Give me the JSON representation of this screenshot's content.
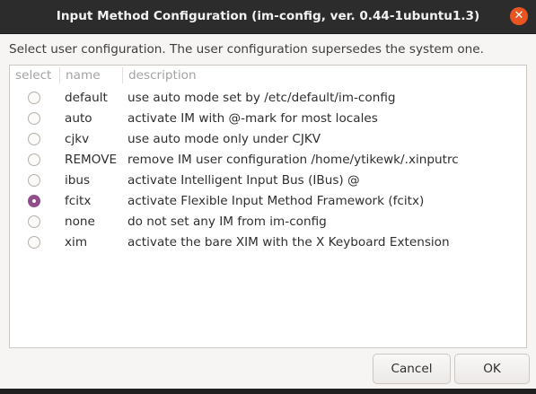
{
  "window": {
    "title": "Input Method Configuration (im-config, ver. 0.44-1ubuntu1.3)",
    "close_glyph": "✕",
    "close_icon": "close-icon"
  },
  "prompt": "Select user configuration. The user configuration supersedes the system one.",
  "columns": {
    "select": "select",
    "name": "name",
    "description": "description"
  },
  "rows": [
    {
      "name": "default",
      "description": "use auto mode set by /etc/default/im-config",
      "selected": false
    },
    {
      "name": "auto",
      "description": "activate IM with @-mark for most locales",
      "selected": false
    },
    {
      "name": "cjkv",
      "description": "use auto mode only under CJKV",
      "selected": false
    },
    {
      "name": "REMOVE",
      "description": "remove IM user configuration /home/ytikewk/.xinputrc",
      "selected": false
    },
    {
      "name": "ibus",
      "description": "activate Intelligent Input Bus (IBus) @",
      "selected": false
    },
    {
      "name": "fcitx",
      "description": "activate Flexible Input Method Framework (fcitx)",
      "selected": true
    },
    {
      "name": "none",
      "description": "do not set any IM from im-config",
      "selected": false
    },
    {
      "name": "xim",
      "description": "activate the bare XIM with the X Keyboard Extension",
      "selected": false
    }
  ],
  "buttons": {
    "cancel": "Cancel",
    "ok": "OK"
  },
  "colors": {
    "titlebar": "#2c2c2c",
    "close_button": "#e95420",
    "radio_checked": "#924d8b"
  }
}
